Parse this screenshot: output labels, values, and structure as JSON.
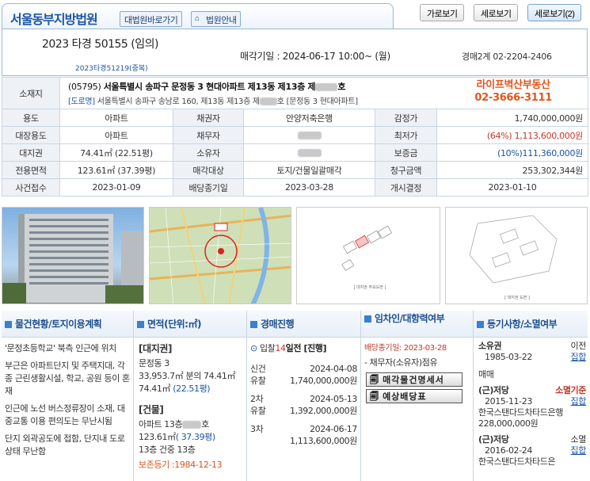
{
  "tabs": {
    "court_name": "서울동부지방법원",
    "btn_court_shortcut": "대법원바로가기",
    "btn_court_guide": "법원안내",
    "view_landscape": "가로보기",
    "view_portrait": "세로보기",
    "view_portrait2": "세로보기(2)"
  },
  "header": {
    "case_number": "2023 타경 50155 (임의)",
    "related_case": "2023타경51219(중복)",
    "auction_date": "매각기일 : 2024-06-17 10:00~ (월)",
    "contact": "경매2계 02-2204-2406"
  },
  "address": {
    "label": "소재지",
    "line1_prefix": "(05795)",
    "line1": "서울특별시 송파구 문정동 3 현대아파트 제13동 제13층 제",
    "line1_suffix": "호",
    "road_tag": "[도로명]",
    "line2": "서울특별시 송파구 송남로 160, 제13동 제13층 제",
    "line2_suffix": "호 [문정동 3 현대아파트]",
    "realtor_name": "라이프벽산부동산",
    "realtor_phone": "02-3666-3111"
  },
  "info": {
    "r1": {
      "l1": "용도",
      "v1": "아파트",
      "l2": "채권자",
      "v2": "안양저축은행",
      "l3": "감정가",
      "v3": "1,740,000,000원"
    },
    "r2": {
      "l1": "대장용도",
      "v1": "아파트",
      "l2": "채무자",
      "l3": "최저가",
      "v3a": "(64%)",
      "v3b": "1,113,600,000원"
    },
    "r3": {
      "l1": "대지권",
      "v1": "74.41㎡ (22.51평)",
      "l2": "소유자",
      "l3": "보증금",
      "v3": "(10%)111,360,000원"
    },
    "r4": {
      "l1": "전용면적",
      "v1": "123.61㎡ (37.39평)",
      "l2": "매각대상",
      "v2": "토지/건물일괄매각",
      "l3": "청구금액",
      "v3": "253,302,344원"
    },
    "r5": {
      "l1": "사건접수",
      "v1": "2023-01-09",
      "l2": "배당종기일",
      "v2": "2023-03-28",
      "l3": "개시결정",
      "v3": "2023-01-10"
    }
  },
  "photos": {
    "map_label": "ⓒ",
    "floor_caption": "[ 대지권 주요도면 ]",
    "site_caption": "[ 대지권 도면 ]"
  },
  "sections": {
    "property": {
      "title": "물건현황/토지이용계획",
      "p1": "'문정초등학교' 북측 인근에 위치",
      "p2": "부근은 아파트단지 및 주택지대, 각종 근린생활시설, 학교, 공원 등이 혼재",
      "p3": "인근에 노선 버스정류장이 소재, 대중교통 이용 편의도는 무난시됨",
      "p4": "단지 외곽공도에 접함, 단지내 도로상태 무난함"
    },
    "area": {
      "title": "면적(단위:㎡)",
      "land_head": "[대지권]",
      "land1": "문정동 3",
      "land2": "33,953.7㎡ 분의 74.41㎡",
      "land3a": "74.41㎡",
      "land3b": "(22.51평)",
      "bldg_head": "[건물]",
      "bldg1": "아파트 13층",
      "bldg1_suffix": "호",
      "bldg2a": "123.61㎡",
      "bldg2b": "( 37.39평)",
      "bldg3": "13층 건중 13층",
      "bldg4": "보존등기 :1984-12-13"
    },
    "progress": {
      "title": "경매진행",
      "status_a": "입찰",
      "status_b": "14",
      "status_c": "일전 [진행]",
      "rows": [
        {
          "round": "신건",
          "date": "2024-04-08",
          "result": "유찰",
          "price": "1,740,000,000원"
        },
        {
          "round": "2차",
          "date": "2024-05-13",
          "result": "유찰",
          "price": "1,392,000,000원"
        },
        {
          "round": "3차",
          "date": "2024-06-17",
          "result": "",
          "price": "1,113,600,000원"
        }
      ]
    },
    "tenant": {
      "title": "임차인/대항력여부",
      "deadline": "배당종기일: 2023-03-28",
      "item": "- 채무자(소유자)점유",
      "btn1": "매각물건명세서",
      "btn2": "예상배당표"
    },
    "registry": {
      "title": "등기사항/소멸여부",
      "r1_type": "소유권",
      "r1_status": "이전",
      "r1_date": "1985-03-22",
      "r1_link": "집합",
      "r1_note": "매매",
      "r2_type": "(근)저당",
      "r2_status": "소멸기준",
      "r2_date": "2015-11-23",
      "r2_link": "집합",
      "r2_holder": "한국스탠다드차타드은행",
      "r2_amount": "228,000,000원",
      "r3_type": "(근)저당",
      "r3_status": "소멸",
      "r3_date": "2016-02-24",
      "r3_link": "집합",
      "r3_holder": "한국스탠다드차타드은"
    }
  }
}
